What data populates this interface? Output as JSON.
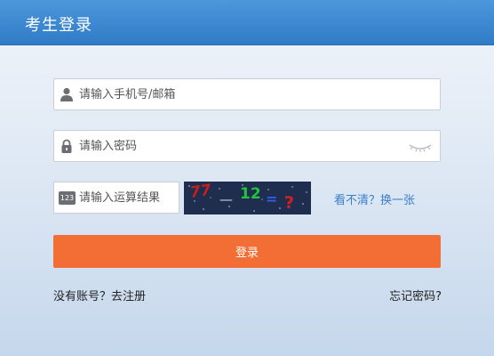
{
  "header": {
    "title": "考生登录"
  },
  "form": {
    "account_placeholder": "请输入手机号/邮箱",
    "password_placeholder": "请输入密码",
    "captcha_placeholder": "请输入运算结果",
    "captcha_icon_text": "123",
    "captcha_image_text": [
      "77",
      "—",
      "12",
      "=",
      "?"
    ],
    "refresh_label": "看不清？换一张",
    "login_label": "登录",
    "register_label": "没有账号？去注册",
    "forgot_label": "忘记密码?"
  },
  "colors": {
    "header": "#2f7bc6",
    "button": "#f36e34",
    "link": "#3a7fcb"
  }
}
